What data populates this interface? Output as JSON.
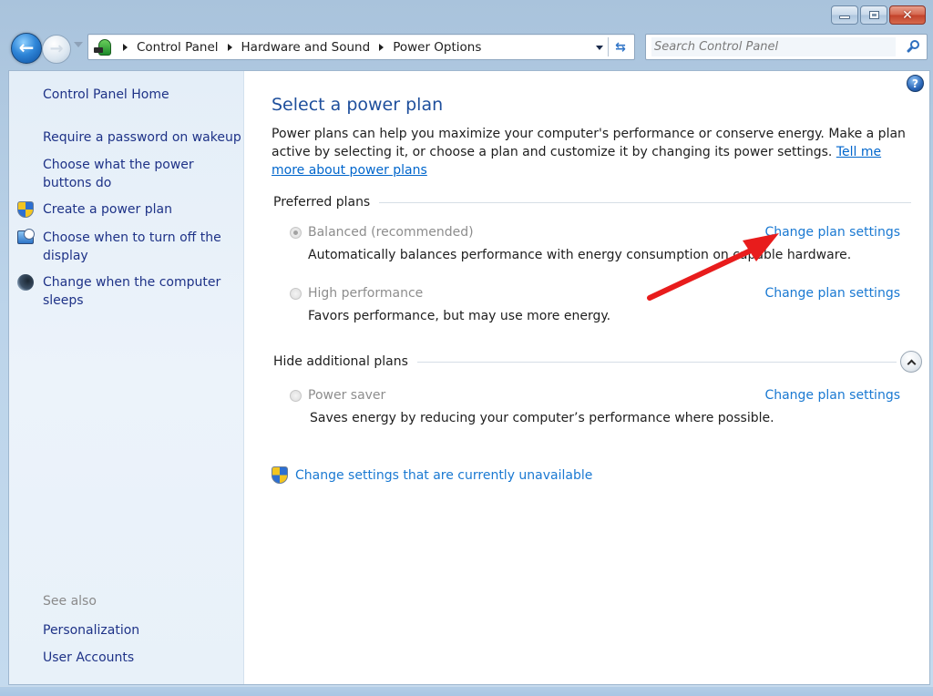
{
  "window": {
    "controls": {
      "minimize": "minimize",
      "maximize": "maximize",
      "close": "close",
      "close_glyph": "✕"
    }
  },
  "navigation": {
    "back_glyph": "←",
    "forward_glyph": "→",
    "breadcrumb": [
      "Control Panel",
      "Hardware and Sound",
      "Power Options"
    ],
    "refresh_glyph": "⇆",
    "search": {
      "placeholder": "Search Control Panel",
      "value": ""
    }
  },
  "sidebar": {
    "home": "Control Panel Home",
    "tasks": [
      {
        "label_lines": [
          "Require a password on wakeup"
        ],
        "icon": "none"
      },
      {
        "label_lines": [
          "Choose what the power",
          "buttons do"
        ],
        "icon": "none"
      },
      {
        "label_lines": [
          "Create a power plan"
        ],
        "icon": "uac-shield-icon"
      },
      {
        "label_lines": [
          "Choose when to turn off the",
          "display"
        ],
        "icon": "display-clock-icon"
      },
      {
        "label_lines": [
          "Change when the computer",
          "sleeps"
        ],
        "icon": "sleep-moon-icon"
      }
    ],
    "see_also_heading": "See also",
    "see_also": [
      "Personalization",
      "User Accounts"
    ]
  },
  "main": {
    "help_glyph": "?",
    "title": "Select a power plan",
    "intro_text": "Power plans can help you maximize your computer's performance or conserve energy. Make a plan active by selecting it, or choose a plan and customize it by changing its power settings. ",
    "intro_link": "Tell me more about power plans",
    "preferred_heading": "Preferred plans",
    "additional_heading": "Hide additional plans",
    "plans": [
      {
        "name": "Balanced (recommended)",
        "selected": true,
        "description": "Automatically balances performance with energy consumption on capable hardware.",
        "link": "Change plan settings"
      },
      {
        "name": "High performance",
        "selected": false,
        "description": "Favors performance, but may use more energy.",
        "link": "Change plan settings"
      },
      {
        "name": "Power saver",
        "selected": false,
        "description": "Saves energy by reducing your computer’s performance where possible.",
        "link": "Change plan settings"
      }
    ],
    "unavailable_link": "Change settings that are currently unavailable"
  },
  "annotation": {
    "type": "red-arrow",
    "points_to": "Change plan settings (Balanced)",
    "color": "#e81c1c"
  }
}
